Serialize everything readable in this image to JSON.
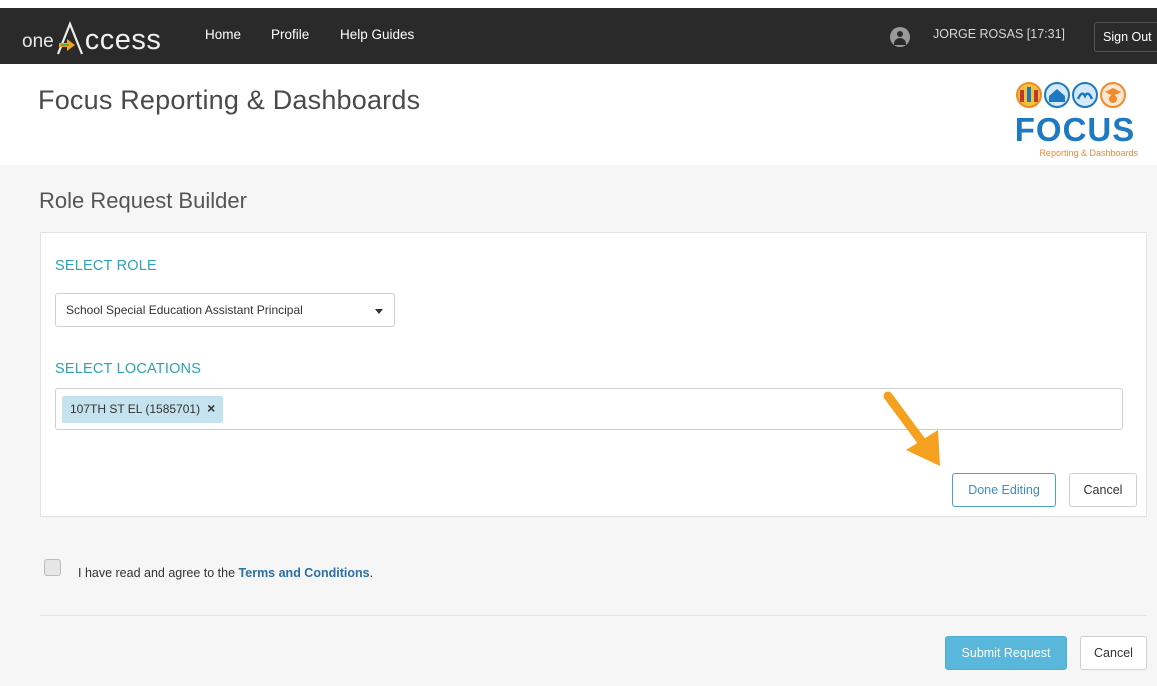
{
  "nav": {
    "brand_one": "one",
    "brand_access": "ccess",
    "links": [
      "Home",
      "Profile",
      "Help Guides"
    ],
    "user": "JORGE ROSAS [17:31]",
    "signout": "Sign Out"
  },
  "header": {
    "title": "Focus Reporting & Dashboards",
    "logo_word": "FOCUS",
    "logo_sub": "Reporting & Dashboards"
  },
  "builder": {
    "title": "Role Request Builder",
    "role_label": "SELECT ROLE",
    "role_value": "School Special Education Assistant Principal",
    "locations_label": "SELECT LOCATIONS",
    "location_tag": "107TH ST EL (1585701)",
    "tag_remove": "×",
    "done_button": "Done Editing",
    "cancel_button": "Cancel"
  },
  "terms": {
    "prefix": "I have read and agree to the ",
    "link": "Terms and Conditions",
    "suffix": "."
  },
  "footer": {
    "submit": "Submit Request",
    "cancel": "Cancel"
  },
  "colors": {
    "navbar": "#2a2a2a",
    "accent_teal": "#2aa3b3",
    "accent_blue": "#3a8fc9",
    "submit_bg": "#58b7da",
    "arrow": "#f5a01f"
  }
}
